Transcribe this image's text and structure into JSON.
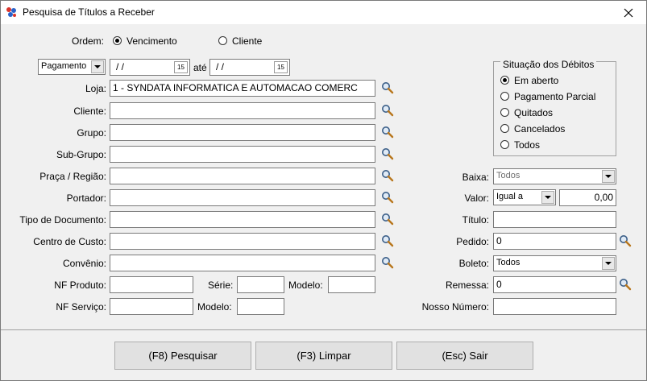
{
  "window": {
    "title": "Pesquisa de Títulos a Receber"
  },
  "ordem": {
    "label": "Ordem:",
    "options": [
      {
        "label": "Vencimento",
        "checked": true
      },
      {
        "label": "Cliente",
        "checked": false
      }
    ]
  },
  "date_filter": {
    "type_value": "Pagamento",
    "from": " /  /",
    "to": " /  /",
    "ate_label": "até",
    "calendar_label": "15"
  },
  "situacao": {
    "legend": "Situação dos Débitos",
    "options": [
      {
        "label": "Em aberto",
        "checked": true
      },
      {
        "label": "Pagamento Parcial",
        "checked": false
      },
      {
        "label": "Quitados",
        "checked": false
      },
      {
        "label": "Cancelados",
        "checked": false
      },
      {
        "label": "Todos",
        "checked": false
      }
    ]
  },
  "left_fields": {
    "loja": {
      "label": "Loja:",
      "value": "1 - SYNDATA INFORMATICA E AUTOMACAO COMERC"
    },
    "cliente": {
      "label": "Cliente:",
      "value": ""
    },
    "grupo": {
      "label": "Grupo:",
      "value": ""
    },
    "subgrupo": {
      "label": "Sub-Grupo:",
      "value": ""
    },
    "praca": {
      "label": "Praça / Região:",
      "value": ""
    },
    "portador": {
      "label": "Portador:",
      "value": ""
    },
    "tipo_doc": {
      "label": "Tipo de Documento:",
      "value": ""
    },
    "centro_custo": {
      "label": "Centro de Custo:",
      "value": ""
    },
    "convenio": {
      "label": "Convênio:",
      "value": ""
    }
  },
  "nf_produto": {
    "label": "NF Produto:",
    "value": "",
    "serie_label": "Série:",
    "serie_value": "",
    "modelo_label": "Modelo:",
    "modelo_value": ""
  },
  "nf_servico": {
    "label": "NF Serviço:",
    "value": "",
    "modelo_label": "Modelo:",
    "modelo_value": ""
  },
  "right_fields": {
    "baixa": {
      "label": "Baixa:",
      "value": "Todos"
    },
    "valor": {
      "label": "Valor:",
      "operator": "Igual a",
      "value": "0,00"
    },
    "titulo": {
      "label": "Título:",
      "value": ""
    },
    "pedido": {
      "label": "Pedido:",
      "value": "0"
    },
    "boleto": {
      "label": "Boleto:",
      "value": "Todos"
    },
    "remessa": {
      "label": "Remessa:",
      "value": "0"
    },
    "nosso_numero": {
      "label": "Nosso Número:",
      "value": ""
    }
  },
  "buttons": {
    "pesquisar": "(F8) Pesquisar",
    "limpar": "(F3) Limpar",
    "sair": "(Esc) Sair"
  },
  "icons": {
    "app": "app-logo-icon",
    "close": "close-icon",
    "search": "search-icon",
    "calendar": "calendar-icon",
    "dropdown": "chevron-down-icon"
  }
}
